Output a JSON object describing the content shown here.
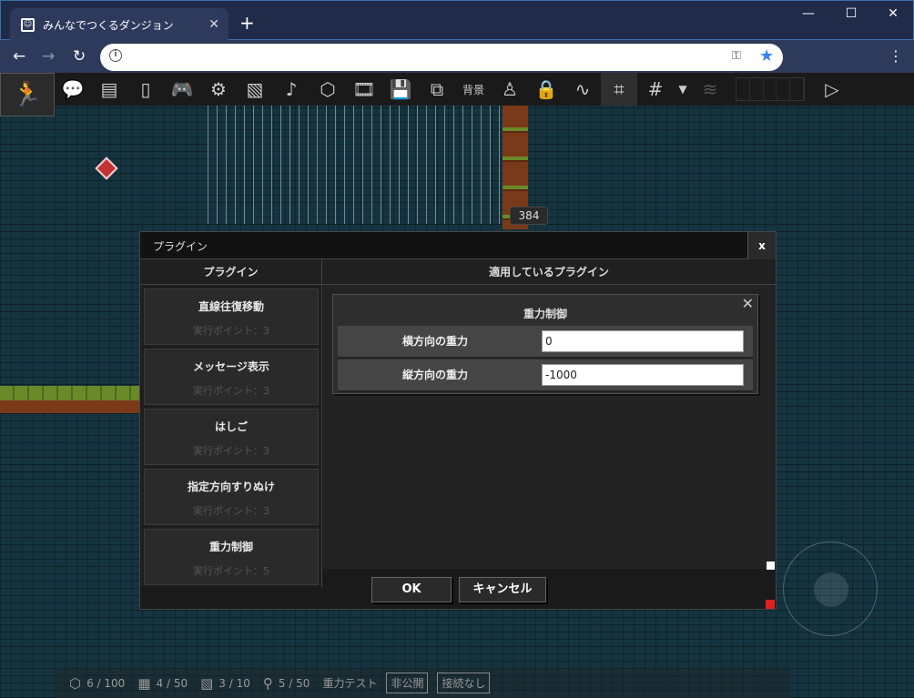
{
  "browser": {
    "tab_title": "みんなでつくるダンジョン",
    "new_tab": "+",
    "minimize": "—",
    "maximize": "☐",
    "close": "✕"
  },
  "toolbar": {
    "bg_label": "背景",
    "icons": [
      "speech-bubble-icon",
      "layers-icon",
      "door-icon",
      "gamepad-icon",
      "gear-icon",
      "image-icon",
      "music-icon",
      "cube-icon",
      "film-icon",
      "save-icon",
      "plugin-icon",
      "background-label",
      "person-icon",
      "lock-icon",
      "path-icon",
      "select-grid-icon",
      "grid-icon",
      "dropdown-icon",
      "stack-icon",
      "play-icon"
    ]
  },
  "map": {
    "coord": "384"
  },
  "dialog": {
    "title": "プラグイン",
    "close": "x",
    "left_header": "プラグイン",
    "right_header": "適用しているプラグイン",
    "plugins": [
      {
        "name": "直線往復移動",
        "points": "実行ポイント：3"
      },
      {
        "name": "メッセージ表示",
        "points": "実行ポイント：3"
      },
      {
        "name": "はしご",
        "points": "実行ポイント：3"
      },
      {
        "name": "指定方向すりぬけ",
        "points": "実行ポイント：3"
      },
      {
        "name": "重力制御",
        "points": "実行ポイント：5"
      }
    ],
    "applied": {
      "title": "重力制御",
      "close": "✕",
      "params": [
        {
          "label": "横方向の重力",
          "value": "0"
        },
        {
          "label": "縦方向の重力",
          "value": "-1000"
        }
      ]
    },
    "ok": "OK",
    "cancel": "キャンセル"
  },
  "status": {
    "objects": "6 / 100",
    "frames": "4 / 50",
    "images": "3 / 10",
    "plugins": "5 / 50",
    "map_name": "重力テスト",
    "visibility": "非公開",
    "connection": "接続なし"
  }
}
